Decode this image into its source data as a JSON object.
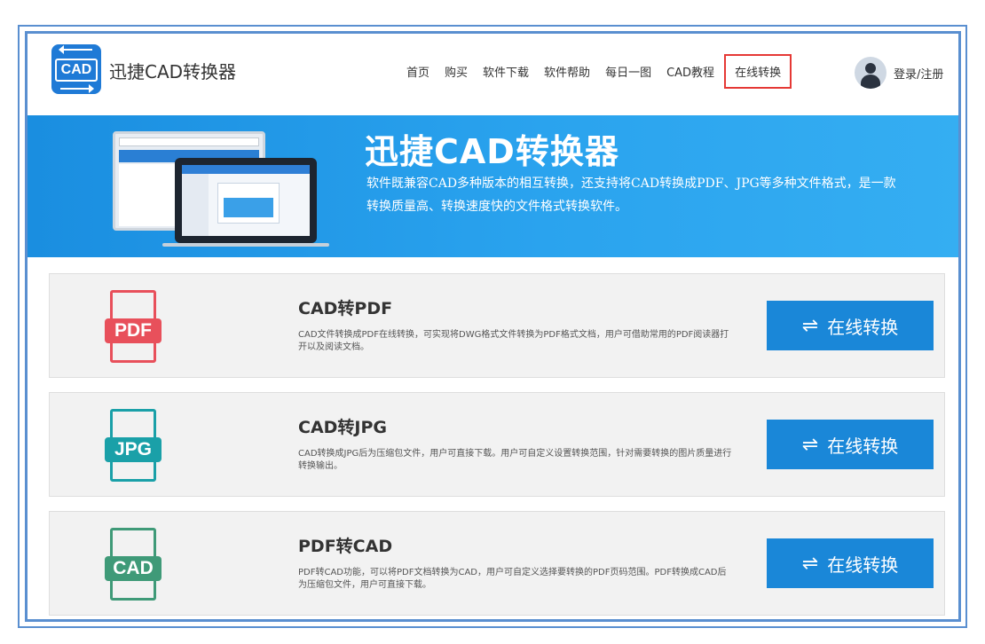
{
  "header": {
    "logo_text": "CAD",
    "brand": "迅捷CAD转换器",
    "nav": [
      "首页",
      "购买",
      "软件下载",
      "软件帮助",
      "每日一图",
      "CAD教程",
      "在线转换"
    ],
    "login": "登录/注册"
  },
  "banner": {
    "title": "迅捷CAD转换器",
    "description": "软件既兼容CAD多种版本的相互转换，还支持将CAD转换成PDF、JPG等多种文件格式，是一款转换质量高、转换速度快的文件格式转换软件。"
  },
  "cards": [
    {
      "icon_label": "PDF",
      "title": "CAD转PDF",
      "description": "CAD文件转换成PDF在线转换，可实现将DWG格式文件转换为PDF格式文档，用户可借助常用的PDF阅读器打开以及阅读文档。",
      "button": "在线转换",
      "color": "#e8505b"
    },
    {
      "icon_label": "JPG",
      "title": "CAD转JPG",
      "description": "CAD转换成JPG后为压缩包文件，用户可直接下载。用户可自定义设置转换范围，针对需要转换的图片质量进行转换输出。",
      "button": "在线转换",
      "color": "#1aa0a8"
    },
    {
      "icon_label": "CAD",
      "title": "PDF转CAD",
      "description": "PDF转CAD功能，可以将PDF文档转换为CAD，用户可自定义选择要转换的PDF页码范围。PDF转换成CAD后为压缩包文件，用户可直接下载。",
      "button": "在线转换",
      "color": "#3f9a78"
    }
  ],
  "icons": {
    "swap": "swap-arrows-icon",
    "user": "user-avatar-icon"
  }
}
